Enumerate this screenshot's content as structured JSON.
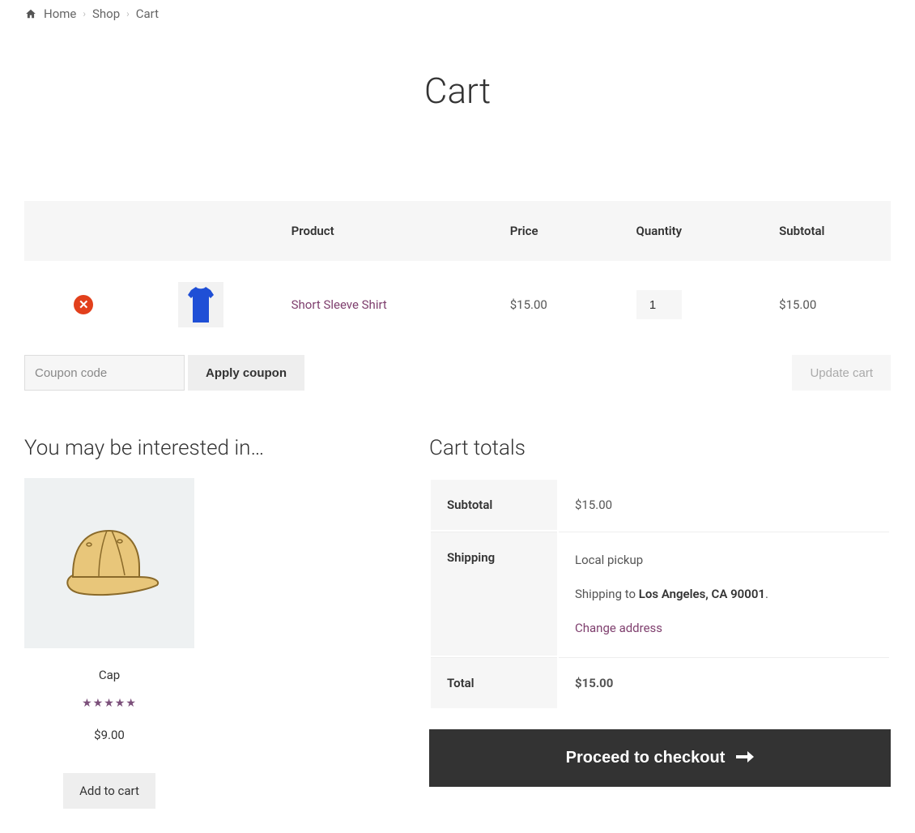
{
  "breadcrumb": {
    "home": "Home",
    "shop": "Shop",
    "cart": "Cart"
  },
  "page_title": "Cart",
  "table": {
    "headers": {
      "product": "Product",
      "price": "Price",
      "quantity": "Quantity",
      "subtotal": "Subtotal"
    },
    "row": {
      "product_name": "Short Sleeve Shirt",
      "price": "$15.00",
      "quantity": "1",
      "subtotal": "$15.00"
    }
  },
  "coupon": {
    "placeholder": "Coupon code",
    "apply_label": "Apply coupon"
  },
  "update_cart_label": "Update cart",
  "interested_heading": "You may be interested in…",
  "upsell": {
    "name": "Cap",
    "stars": "★★★★★",
    "price": "$9.00",
    "add_label": "Add to cart"
  },
  "totals": {
    "heading": "Cart totals",
    "subtotal_label": "Subtotal",
    "subtotal_value": "$15.00",
    "shipping_label": "Shipping",
    "shipping_method": "Local pickup",
    "shipping_to_prefix": "Shipping to ",
    "shipping_destination": "Los Angeles, CA 90001",
    "change_address": "Change address",
    "total_label": "Total",
    "total_value": "$15.00"
  },
  "checkout_label": "Proceed to checkout"
}
